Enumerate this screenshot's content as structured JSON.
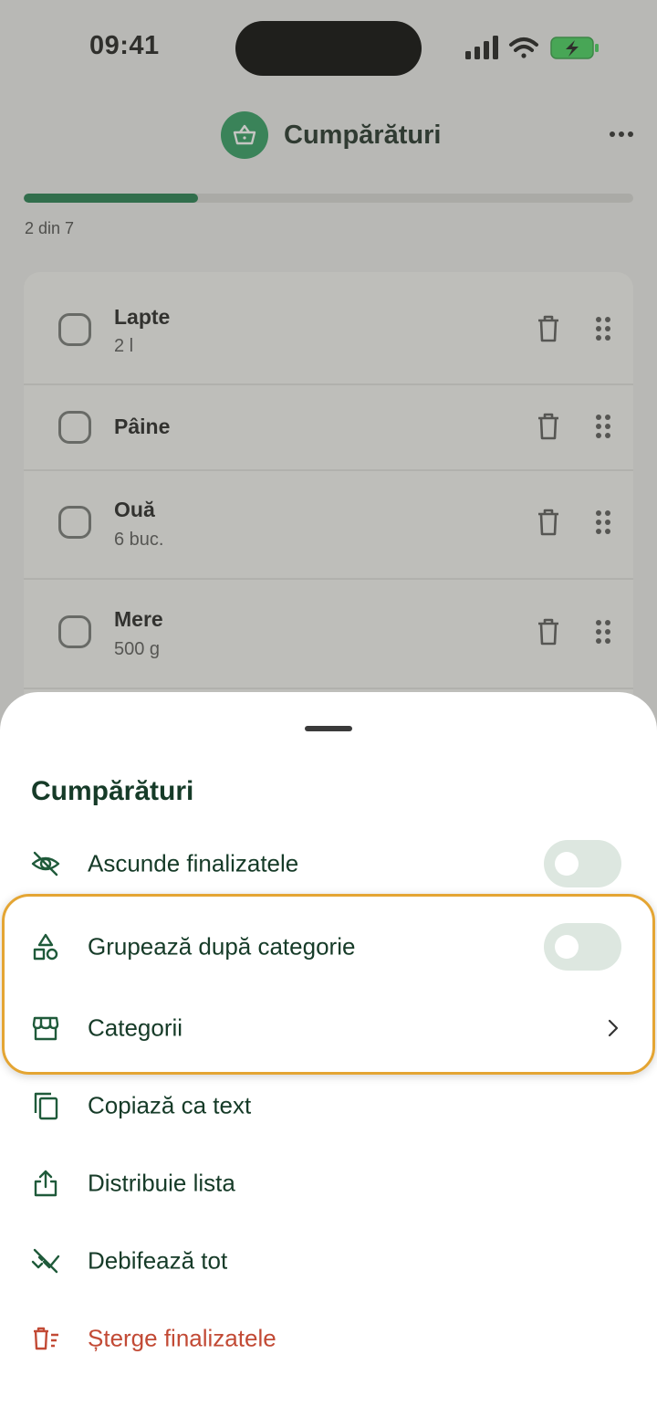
{
  "status": {
    "time": "09:41"
  },
  "header": {
    "title": "Cumpărături"
  },
  "progress": {
    "label": "2 din 7",
    "fraction": 0.2857
  },
  "items": [
    {
      "name": "Lapte",
      "qty": "2 l"
    },
    {
      "name": "Pâine",
      "qty": ""
    },
    {
      "name": "Ouă",
      "qty": "6 buc."
    },
    {
      "name": "Mere",
      "qty": "500 g"
    }
  ],
  "sheet": {
    "title": "Cumpărături",
    "menu": [
      {
        "label": "Ascunde finalizatele",
        "icon": "eye-off-icon",
        "control": "toggle",
        "on": false
      },
      {
        "label": "Grupează după categorie",
        "icon": "shapes-icon",
        "control": "toggle",
        "on": false
      },
      {
        "label": "Categorii",
        "icon": "store-icon",
        "control": "chevron"
      },
      {
        "label": "Copiază ca text",
        "icon": "copy-icon"
      },
      {
        "label": "Distribuie lista",
        "icon": "share-icon"
      },
      {
        "label": "Debifează tot",
        "icon": "remove-done-icon"
      },
      {
        "label": "Șterge finalizatele",
        "icon": "delete-sweep-icon",
        "danger": true
      }
    ]
  },
  "colors": {
    "accent": "#1c7a4a",
    "badge": "#2a9a5e",
    "danger": "#c24a35",
    "highlight": "#e4a533",
    "battery": "#3fcf5a"
  }
}
